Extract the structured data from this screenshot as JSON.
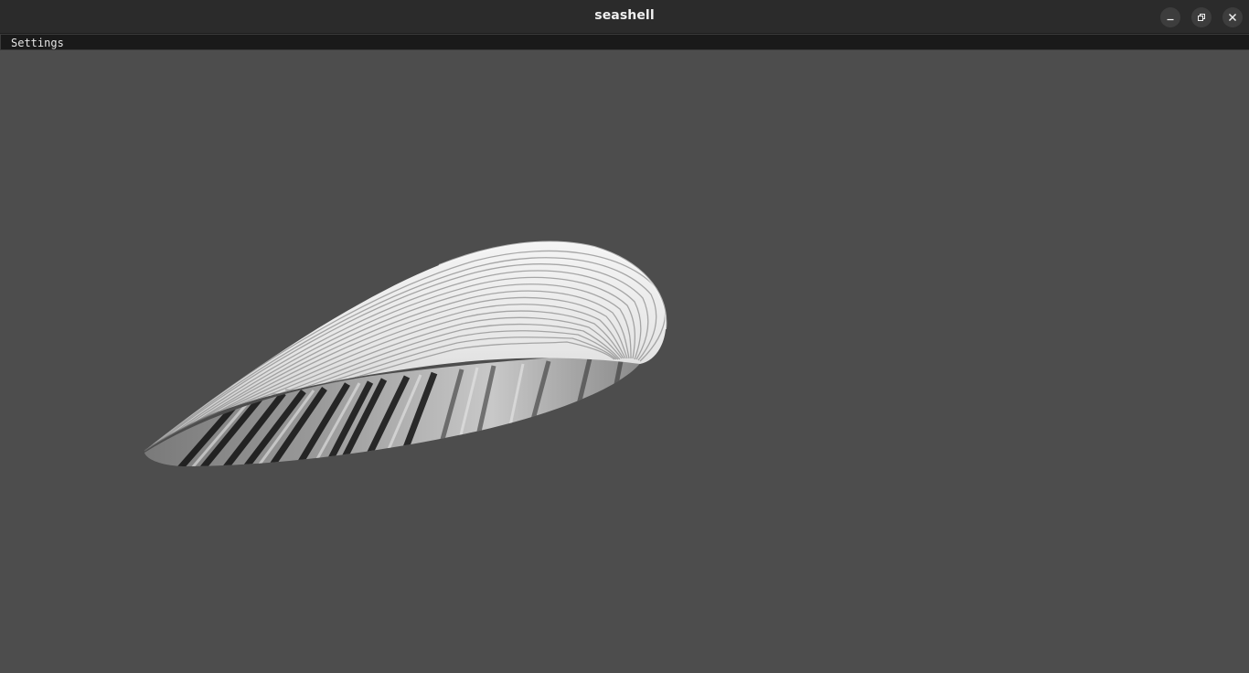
{
  "window": {
    "title": "seashell",
    "controls": {
      "minimize": "minimize-icon",
      "maximize": "maximize-icon",
      "close": "close-icon"
    }
  },
  "menubar": {
    "items": [
      {
        "label": "Settings"
      }
    ]
  },
  "viewport": {
    "background": "#4d4d4d",
    "model": "seashell"
  }
}
